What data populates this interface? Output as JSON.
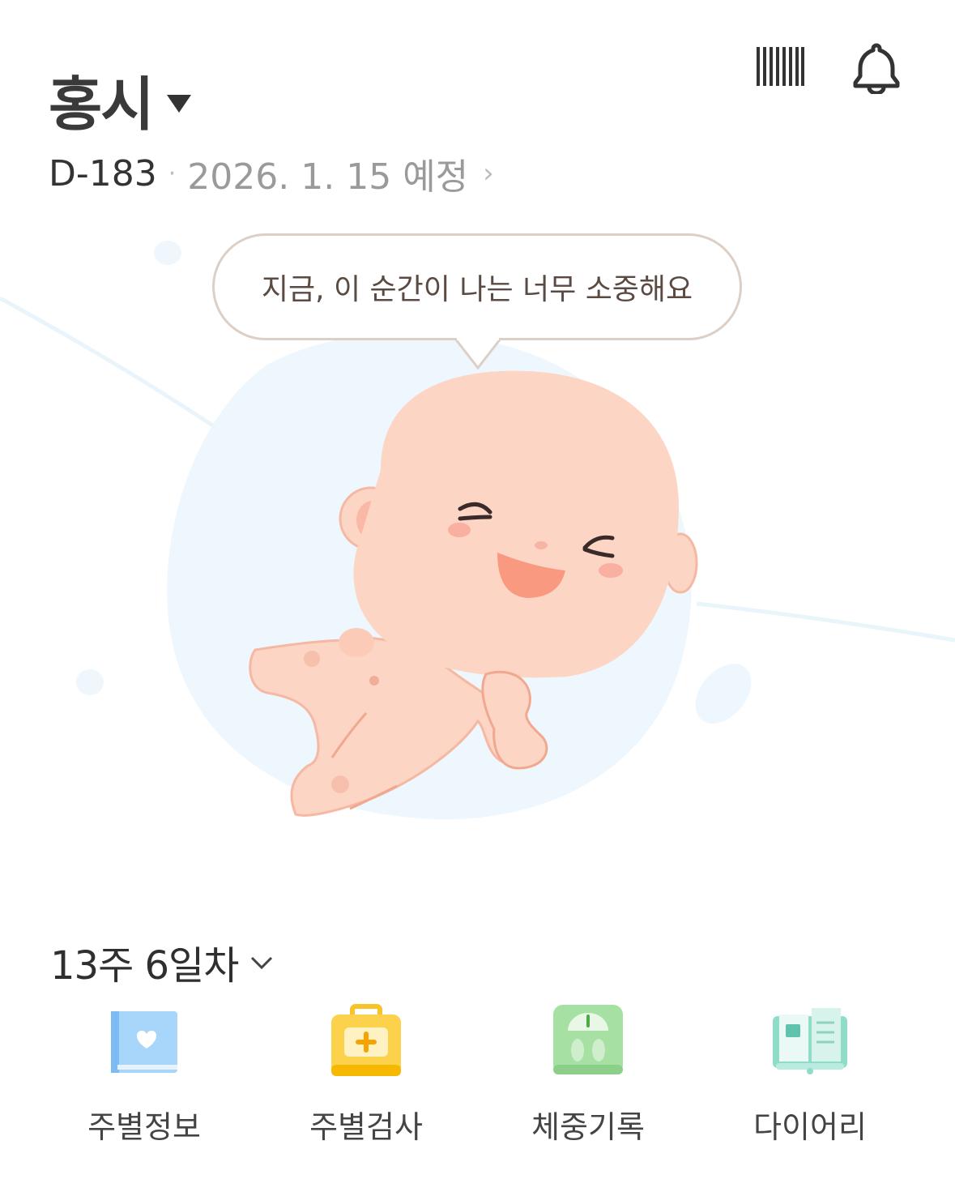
{
  "header": {
    "title": "홍시",
    "dday": "D-183",
    "due_date": "2026. 1. 15 예정"
  },
  "speech_bubble": "지금, 이 순간이 나는 너무 소중해요",
  "week": {
    "label": "13주 6일차"
  },
  "menu": [
    {
      "label": "주별정보",
      "icon": "blue-book-heart-icon"
    },
    {
      "label": "주별검사",
      "icon": "medical-kit-icon"
    },
    {
      "label": "체중기록",
      "icon": "scale-icon"
    },
    {
      "label": "다이어리",
      "icon": "diary-icon"
    }
  ],
  "colors": {
    "bubble_border": "#dccfc6",
    "baby_skin": "#fdd5c4",
    "bg_blob": "#eef7fd"
  }
}
